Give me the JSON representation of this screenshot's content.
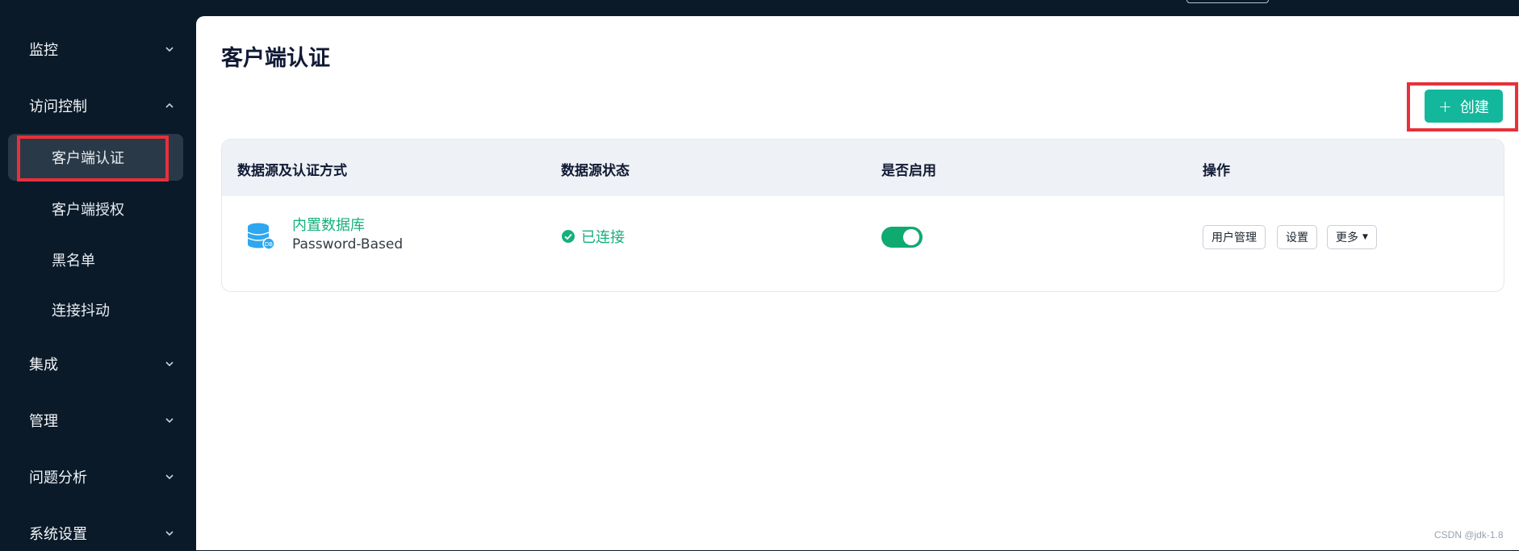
{
  "sidebar": {
    "groups": [
      {
        "label": "监控"
      },
      {
        "label": "访问控制"
      },
      {
        "label": "集成"
      },
      {
        "label": "管理"
      },
      {
        "label": "问题分析"
      },
      {
        "label": "系统设置"
      }
    ],
    "access_control_items": [
      {
        "label": "客户端认证",
        "active": true
      },
      {
        "label": "客户端授权"
      },
      {
        "label": "黑名单"
      },
      {
        "label": "连接抖动"
      }
    ]
  },
  "main": {
    "title": "客户端认证",
    "create_label": "创建",
    "table": {
      "headers": [
        "数据源及认证方式",
        "数据源状态",
        "是否启用",
        "操作"
      ],
      "rows": [
        {
          "source_name": "内置数据库",
          "mechanism": "Password-Based",
          "status": "已连接",
          "enabled": true,
          "actions": {
            "user_mgmt": "用户管理",
            "settings": "设置",
            "more": "更多"
          }
        }
      ]
    }
  },
  "watermark": "CSDN @jdk-1.8",
  "colors": {
    "sidebar_bg": "#0b1a29",
    "accent": "#13b79c",
    "success": "#16b07c",
    "highlight": "#e8303a"
  }
}
